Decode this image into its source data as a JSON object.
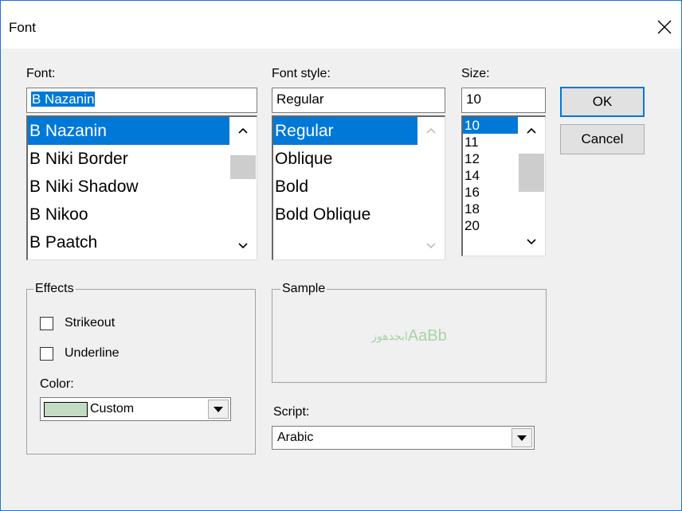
{
  "dialog": {
    "title": "Font",
    "close_label": "×"
  },
  "font": {
    "label": "Font:",
    "value": "B Nazanin",
    "items": [
      "B Nazanin",
      "B Niki Border",
      "B Niki Shadow",
      "B Nikoo",
      "B Paatch"
    ],
    "selected_index": 0
  },
  "font_style": {
    "label": "Font style:",
    "value": "Regular",
    "items": [
      "Regular",
      "Oblique",
      "Bold",
      "Bold Oblique"
    ],
    "selected_index": 0
  },
  "size": {
    "label": "Size:",
    "value": "10",
    "items": [
      "10",
      "11",
      "12",
      "14",
      "16",
      "18",
      "20"
    ],
    "selected_index": 0
  },
  "buttons": {
    "ok": "OK",
    "cancel": "Cancel"
  },
  "effects": {
    "title": "Effects",
    "strikeout": {
      "label": "Strikeout",
      "checked": false
    },
    "underline": {
      "label": "Underline",
      "checked": false
    },
    "color_label": "Color:",
    "color_value": "Custom",
    "color_swatch": "#c1dcc3"
  },
  "sample": {
    "title": "Sample",
    "latin": "AaBb",
    "arabic": "ابجدهوز",
    "text_color": "#a9d3a9"
  },
  "script": {
    "label": "Script:",
    "value": "Arabic"
  },
  "colors": {
    "window_bg": "#f0f0f0",
    "selection": "#0078d7",
    "accent_border": "#1a73d9"
  }
}
